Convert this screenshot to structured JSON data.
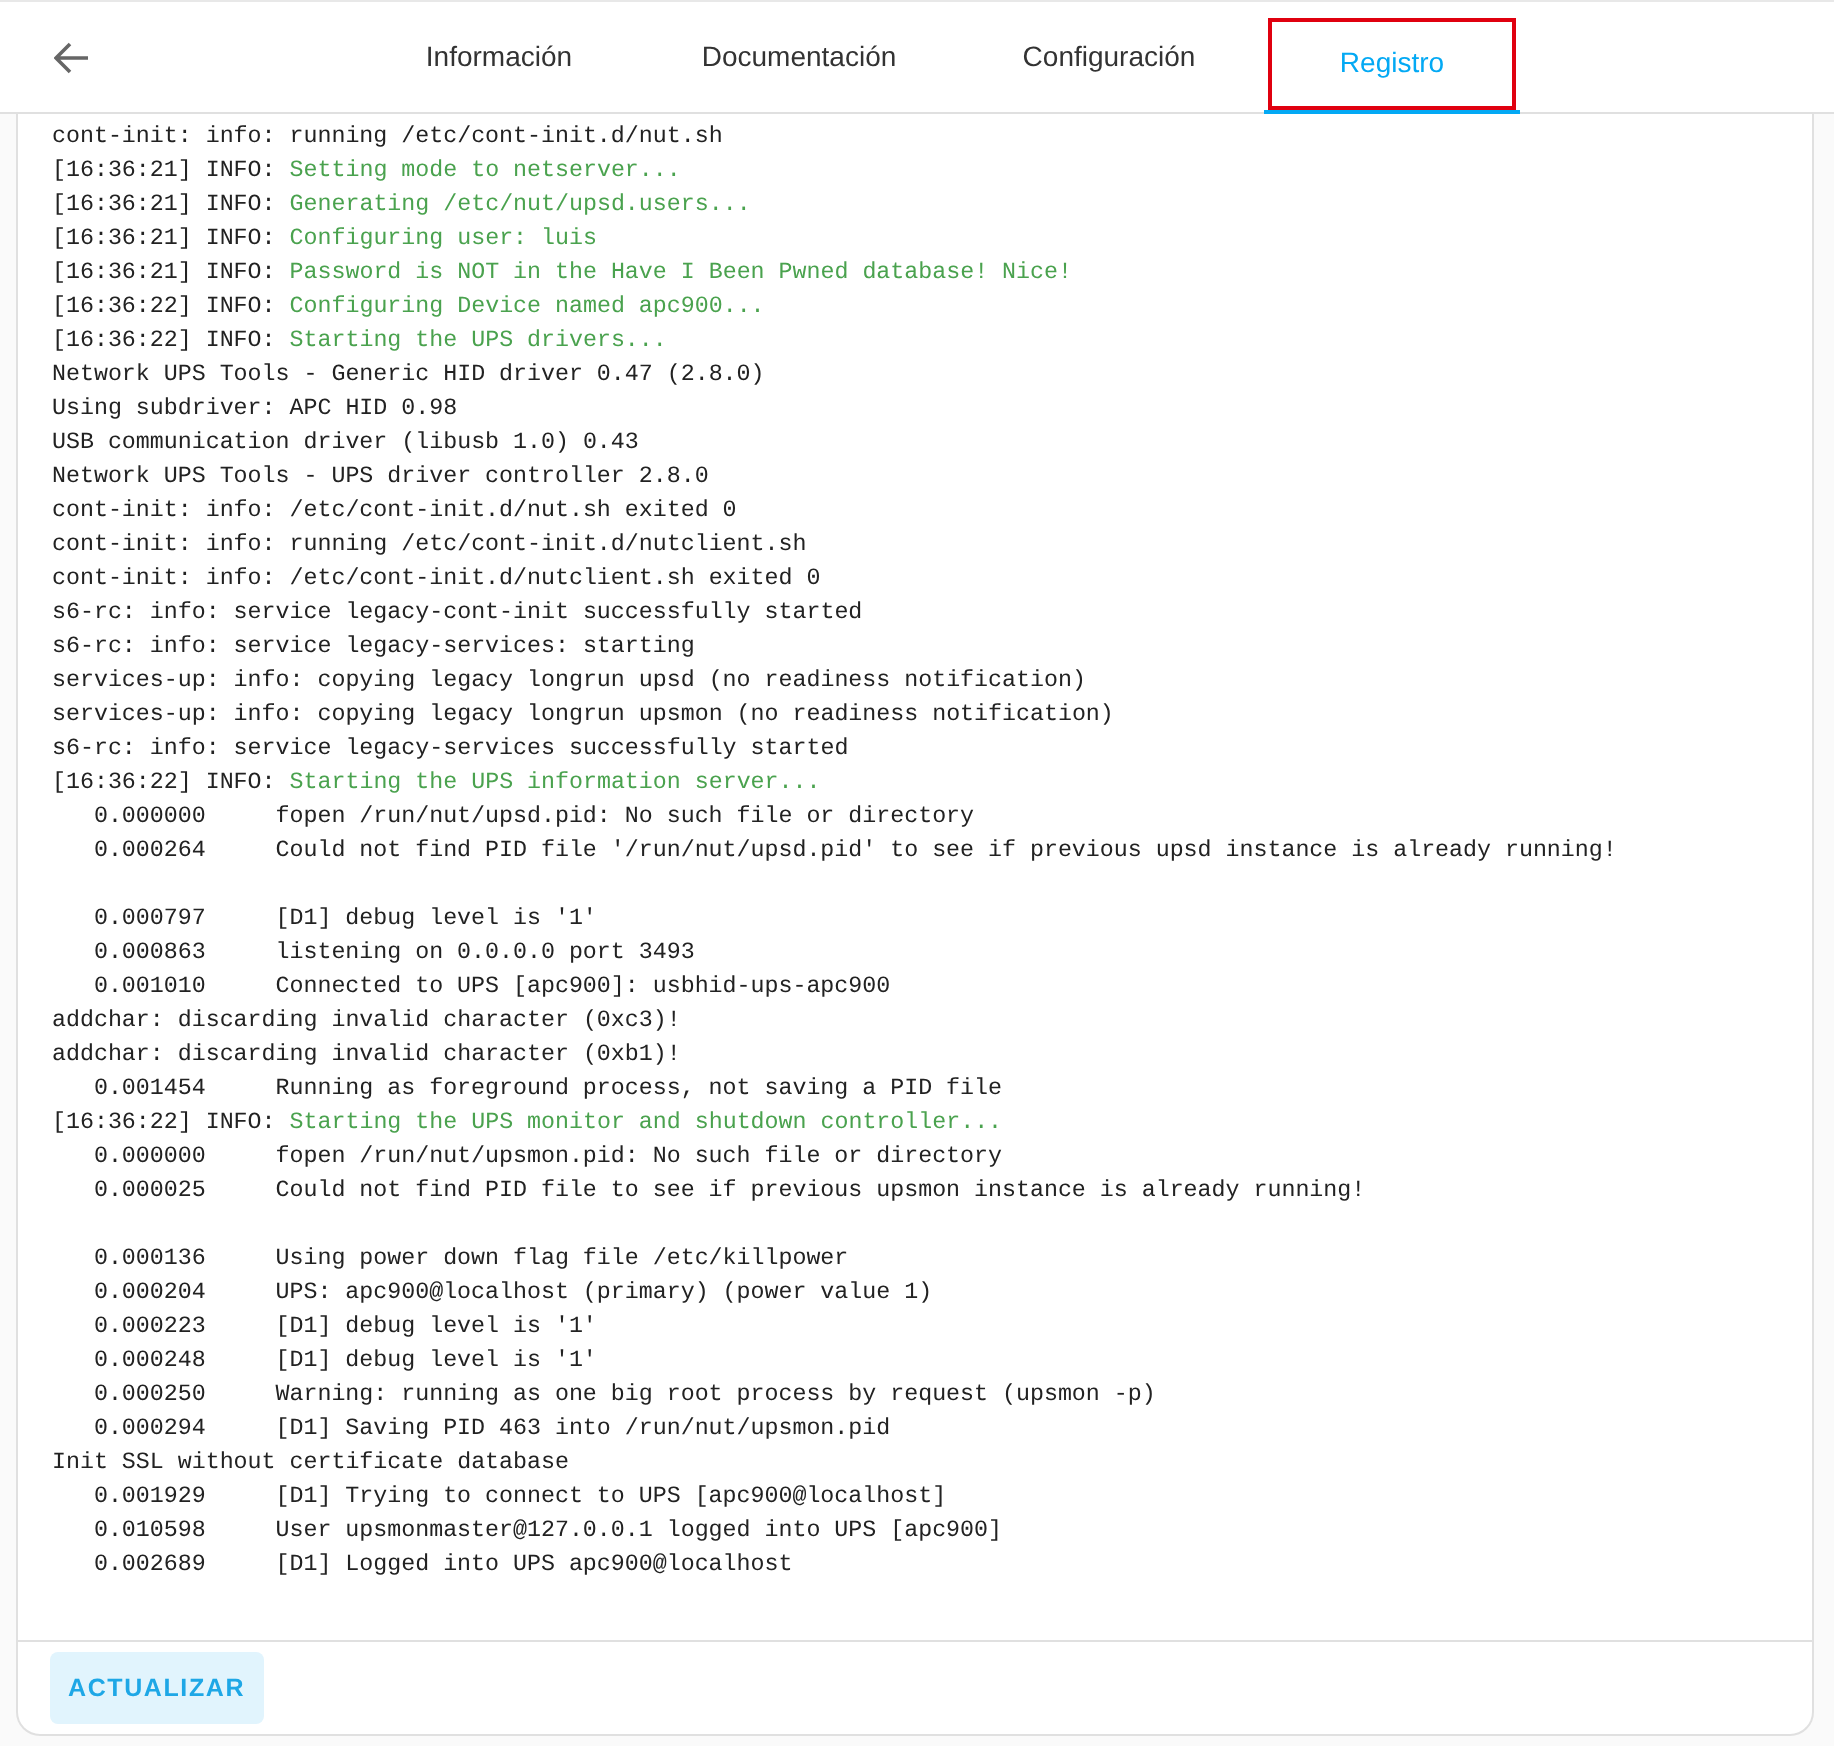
{
  "tabs": [
    {
      "label": "Información",
      "selected": false,
      "highlighted": false
    },
    {
      "label": "Documentación",
      "selected": false,
      "highlighted": false
    },
    {
      "label": "Configuración",
      "selected": false,
      "highlighted": false
    },
    {
      "label": "Registro",
      "selected": true,
      "highlighted": true
    }
  ],
  "log": [
    {
      "kind": "plain",
      "text": "cont-init: info: running /etc/cont-init.d/nut.sh"
    },
    {
      "kind": "info",
      "prefix": "[16:36:21] INFO:",
      "message": "Setting mode to netserver..."
    },
    {
      "kind": "info",
      "prefix": "[16:36:21] INFO:",
      "message": "Generating /etc/nut/upsd.users..."
    },
    {
      "kind": "info",
      "prefix": "[16:36:21] INFO:",
      "message": "Configuring user: luis"
    },
    {
      "kind": "info",
      "prefix": "[16:36:21] INFO:",
      "message": "Password is NOT in the Have I Been Pwned database! Nice!"
    },
    {
      "kind": "info",
      "prefix": "[16:36:22] INFO:",
      "message": "Configuring Device named apc900..."
    },
    {
      "kind": "info",
      "prefix": "[16:36:22] INFO:",
      "message": "Starting the UPS drivers..."
    },
    {
      "kind": "plain",
      "text": "Network UPS Tools - Generic HID driver 0.47 (2.8.0)"
    },
    {
      "kind": "plain",
      "text": "Using subdriver: APC HID 0.98"
    },
    {
      "kind": "plain",
      "text": "USB communication driver (libusb 1.0) 0.43"
    },
    {
      "kind": "plain",
      "text": "Network UPS Tools - UPS driver controller 2.8.0"
    },
    {
      "kind": "plain",
      "text": "cont-init: info: /etc/cont-init.d/nut.sh exited 0"
    },
    {
      "kind": "plain",
      "text": "cont-init: info: running /etc/cont-init.d/nutclient.sh"
    },
    {
      "kind": "plain",
      "text": "cont-init: info: /etc/cont-init.d/nutclient.sh exited 0"
    },
    {
      "kind": "plain",
      "text": "s6-rc: info: service legacy-cont-init successfully started"
    },
    {
      "kind": "plain",
      "text": "s6-rc: info: service legacy-services: starting"
    },
    {
      "kind": "plain",
      "text": "services-up: info: copying legacy longrun upsd (no readiness notification)"
    },
    {
      "kind": "plain",
      "text": "services-up: info: copying legacy longrun upsmon (no readiness notification)"
    },
    {
      "kind": "plain",
      "text": "s6-rc: info: service legacy-services successfully started"
    },
    {
      "kind": "info",
      "prefix": "[16:36:22] INFO:",
      "message": "Starting the UPS information server..."
    },
    {
      "kind": "timed",
      "time": "0.000000",
      "text": "fopen /run/nut/upsd.pid: No such file or directory"
    },
    {
      "kind": "timed",
      "time": "0.000264",
      "text": "Could not find PID file '/run/nut/upsd.pid' to see if previous upsd instance is already running!"
    },
    {
      "kind": "blank"
    },
    {
      "kind": "timed",
      "time": "0.000797",
      "text": "[D1] debug level is '1'"
    },
    {
      "kind": "timed",
      "time": "0.000863",
      "text": "listening on 0.0.0.0 port 3493"
    },
    {
      "kind": "timed",
      "time": "0.001010",
      "text": "Connected to UPS [apc900]: usbhid-ups-apc900"
    },
    {
      "kind": "plain",
      "text": "addchar: discarding invalid character (0xc3)!"
    },
    {
      "kind": "plain",
      "text": "addchar: discarding invalid character (0xb1)!"
    },
    {
      "kind": "timed",
      "time": "0.001454",
      "text": "Running as foreground process, not saving a PID file"
    },
    {
      "kind": "info",
      "prefix": "[16:36:22] INFO:",
      "message": "Starting the UPS monitor and shutdown controller..."
    },
    {
      "kind": "timed",
      "time": "0.000000",
      "text": "fopen /run/nut/upsmon.pid: No such file or directory"
    },
    {
      "kind": "timed",
      "time": "0.000025",
      "text": "Could not find PID file to see if previous upsmon instance is already running!"
    },
    {
      "kind": "blank"
    },
    {
      "kind": "timed",
      "time": "0.000136",
      "text": "Using power down flag file /etc/killpower"
    },
    {
      "kind": "timed",
      "time": "0.000204",
      "text": "UPS: apc900@localhost (primary) (power value 1)"
    },
    {
      "kind": "timed",
      "time": "0.000223",
      "text": "[D1] debug level is '1'"
    },
    {
      "kind": "timed",
      "time": "0.000248",
      "text": "[D1] debug level is '1'"
    },
    {
      "kind": "timed",
      "time": "0.000250",
      "text": "Warning: running as one big root process by request (upsmon -p)"
    },
    {
      "kind": "timed",
      "time": "0.000294",
      "text": "[D1] Saving PID 463 into /run/nut/upsmon.pid"
    },
    {
      "kind": "plain",
      "text": "Init SSL without certificate database"
    },
    {
      "kind": "timed",
      "time": "0.001929",
      "text": "[D1] Trying to connect to UPS [apc900@localhost]"
    },
    {
      "kind": "timed",
      "time": "0.010598",
      "text": "User upsmonmaster@127.0.0.1 logged into UPS [apc900]"
    },
    {
      "kind": "timed",
      "time": "0.002689",
      "text": "[D1] Logged into UPS apc900@localhost"
    }
  ],
  "refresh_button": "ACTUALIZAR"
}
